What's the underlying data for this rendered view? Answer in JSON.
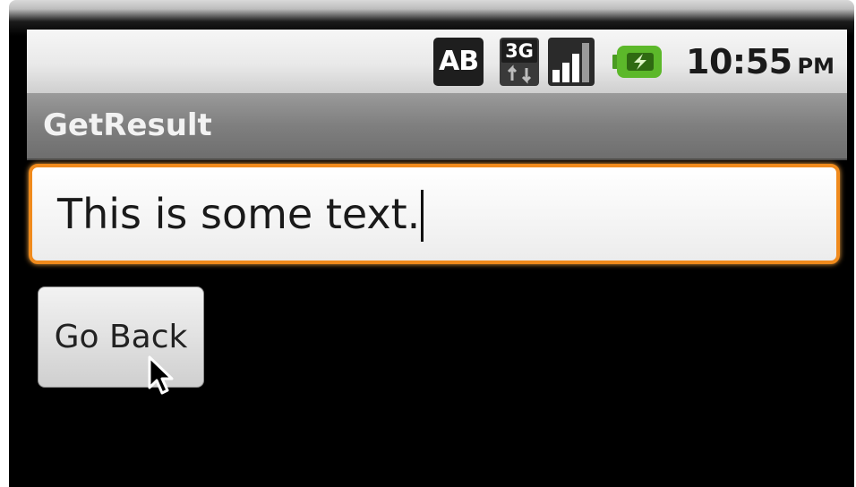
{
  "status_bar": {
    "ab_label": "AB",
    "network_label": "3G",
    "icons": [
      "ab-input-icon",
      "3g-data-icon",
      "signal-strength-icon",
      "battery-charging-icon"
    ],
    "time": "10:55",
    "ampm": "PM"
  },
  "title_bar": {
    "title": "GetResult"
  },
  "text_field": {
    "value": "This is some text."
  },
  "buttons": {
    "go_back": "Go Back"
  },
  "colors": {
    "focus_border": "#f08a1c",
    "battery_green": "#5cb82a",
    "title_bar_gray": "#8a8a8a"
  }
}
